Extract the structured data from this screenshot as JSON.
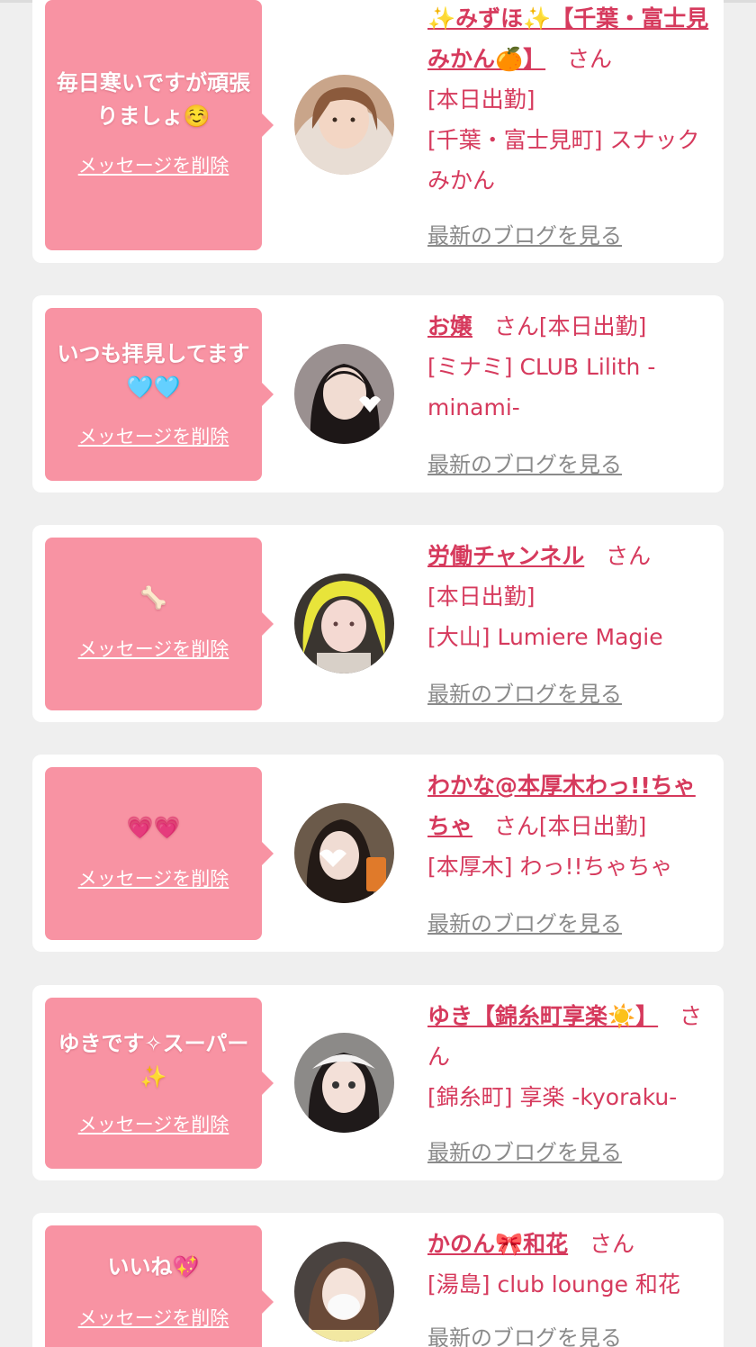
{
  "delete_label": "メッセージを削除",
  "blog_label": "最新のブログを見る",
  "san_label": "さん",
  "colors": {
    "bubble": "#f893a3",
    "accent": "#d63a5d",
    "muted": "#8a8a8a",
    "background": "#efefef"
  },
  "items": [
    {
      "message": "毎日寒いですが頑張りましょ☺️",
      "name": "✨みずほ✨【千葉・富士見みかん🍊】",
      "info": "[本日出勤]",
      "shop": "[千葉・富士見町] スナックみかん"
    },
    {
      "message": "いつも拝見してます🩵🩵",
      "name": "お嬢",
      "info": "[本日出勤]",
      "shop": "[ミナミ] CLUB Lilith -minami-"
    },
    {
      "message": "🦴",
      "name": "労働チャンネル",
      "info": "[本日出勤]",
      "shop": "[大山] Lumiere Magie"
    },
    {
      "message": "💗💗",
      "name": "わかな@本厚木わっ!!ちゃちゃ",
      "info": "[本日出勤]",
      "shop": "[本厚木] わっ!!ちゃちゃ"
    },
    {
      "message": "ゆきです✧スーパー✨",
      "name": "ゆき【錦糸町享楽☀️】",
      "info": "",
      "shop": "[錦糸町] 享楽 -kyoraku-"
    },
    {
      "message": "いいね💖",
      "name": "かのん🎀和花",
      "info": "",
      "shop": "[湯島] club lounge 和花"
    }
  ]
}
